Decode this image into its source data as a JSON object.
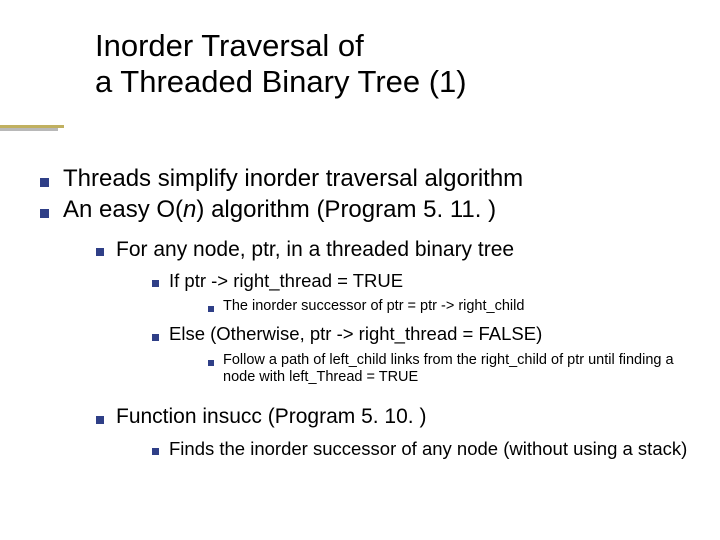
{
  "title": {
    "line1": "Inorder Traversal of",
    "line2": " a Threaded Binary Tree (1)"
  },
  "bullets": {
    "l1_1": "Threads simplify inorder traversal algorithm",
    "l1_2_a": "An easy O(",
    "l1_2_n": "n",
    "l1_2_b": ") algorithm (Program 5. 11. )",
    "l2_1": "For any node, ptr, in a threaded binary tree",
    "l3_1": "If ptr -> right_thread = TRUE",
    "l4_1": "The inorder successor of ptr = ptr -> right_child",
    "l3_2": "Else (Otherwise, ptr -> right_thread = FALSE)",
    "l4_2": "Follow a path of left_child links from the right_child of ptr until finding a node with left_Thread = TRUE",
    "l2_2": "Function insucc (Program 5. 10. )",
    "l3_3": "Finds the inorder successor of any node (without using a stack)"
  }
}
